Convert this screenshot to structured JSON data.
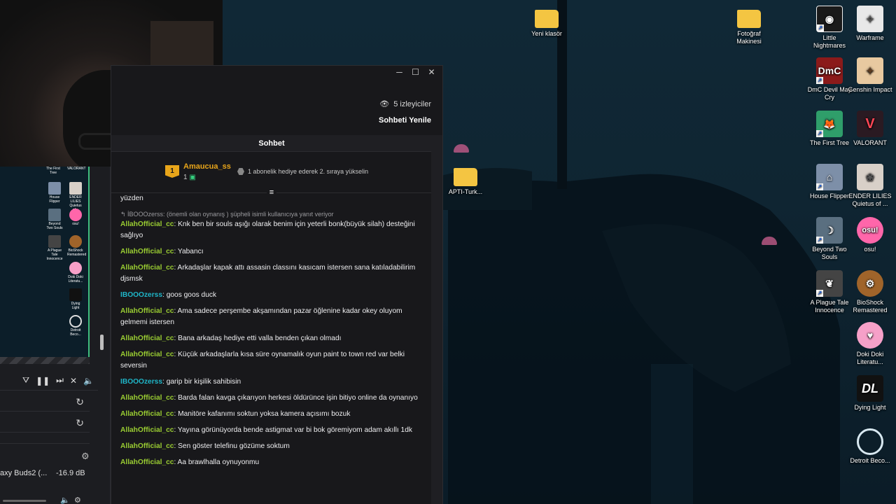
{
  "desktop": {
    "icons": [
      {
        "label": "Yeni klasör",
        "icon": "folder-icon",
        "color": "#f4c542"
      },
      {
        "label": "Fotoğraf Makinesi",
        "icon": "folder-icon",
        "color": "#f4c542"
      },
      {
        "label": "Little Nightmares",
        "icon": "eye-icon",
        "color": "#1a1a1a"
      },
      {
        "label": "Warframe",
        "icon": "warframe-icon",
        "color": "#e8e8e8"
      },
      {
        "label": "DmC Devil May Cry",
        "icon": "dmc-icon",
        "color": "#8b1a1a"
      },
      {
        "label": "Genshin Impact",
        "icon": "genshin-icon",
        "color": "#e8c9a0"
      },
      {
        "label": "The First Tree",
        "icon": "fox-icon",
        "color": "#2f9e6a"
      },
      {
        "label": "VALORANT",
        "icon": "valorant-icon",
        "color": "#ff4655"
      },
      {
        "label": "House Flipper",
        "icon": "house-icon",
        "color": "#7d8fa8"
      },
      {
        "label": "ENDER LILIES Quietus of ...",
        "icon": "ender-lilies-icon",
        "color": "#d8d0c8"
      },
      {
        "label": "Beyond Two Souls",
        "icon": "beyond-icon",
        "color": "#5a6f80"
      },
      {
        "label": "osu!",
        "icon": "osu-icon",
        "color": "#ff66aa"
      },
      {
        "label": "A Plague Tale Innocence",
        "icon": "plague-icon",
        "color": "#444444"
      },
      {
        "label": "BioShock Remastered",
        "icon": "bioshock-icon",
        "color": "#a0642a"
      },
      {
        "label": "Doki Doki Literatu...",
        "icon": "doki-icon",
        "color": "#f6a0c8"
      },
      {
        "label": "Dying Light",
        "icon": "dying-light-icon",
        "color": "#111111"
      },
      {
        "label": "Detroit Beco...",
        "icon": "detroit-icon",
        "color": "#1c3a5a"
      },
      {
        "label": "APTI-Turk...",
        "icon": "folder-icon",
        "color": "#f4c542"
      }
    ]
  },
  "obs": {
    "mini_icons": [
      "The First Tree",
      "VALORANT",
      "House Flipper",
      "ENDER LILIES Quietus of...",
      "Beyond Two Souls",
      "osu!",
      "A Plague Tale Innocence",
      "BioShock Remastered",
      "Doki Doki Literatu...",
      "Dying Light",
      "Detroit Beco..."
    ],
    "audio_device": "axy Buds2 (...",
    "audio_level": "-16.9 dB"
  },
  "chat": {
    "window_controls": {
      "minimize": "─",
      "maximize": "☐",
      "close": "✕"
    },
    "viewers": "5 izleyiciler",
    "refresh": "Sohbeti Yenile",
    "header": "Sohbet",
    "pinned": {
      "rank": "1",
      "username": "Amaucua_ss",
      "count": "1",
      "text": "1 abonelik hediye ederek 2. sıraya yükselin"
    },
    "messages": [
      {
        "user": "",
        "text": "yüzden",
        "color": "#9acd32"
      },
      {
        "reply": "İBOOOzerss: (önemli olan oynanış ) şüpheli isimli kullanıcıya yanıt veriyor"
      },
      {
        "user": "AllahOfficial_cc",
        "text": "Knk ben bir souls aşığı olarak benim için yeterli bonk(büyük silah) desteğini sağlıyo",
        "color": "#9acd32"
      },
      {
        "user": "AllahOfficial_cc",
        "text": "Yabancı",
        "color": "#9acd32"
      },
      {
        "user": "AllahOfficial_cc",
        "text": "Arkadaşlar kapak attı assasin classını kasıcam istersen sana katıladabilirim djsmsk",
        "color": "#9acd32"
      },
      {
        "user": "IBOOOzerss",
        "text": "goos goos duck",
        "color": "#1fb6c8"
      },
      {
        "user": "AllahOfficial_cc",
        "text": "Ama sadece perşembe akşamından pazar öğlenine kadar okey oluyom gelmemi istersen",
        "color": "#9acd32"
      },
      {
        "user": "AllahOfficial_cc",
        "text": "Bana arkadaş hediye etti valla benden çıkan olmadı",
        "color": "#9acd32"
      },
      {
        "user": "AllahOfficial_cc",
        "text": "Küçük arkadaşlarla kısa süre oynamalık oyun paint to town red var belki seversin",
        "color": "#9acd32"
      },
      {
        "user": "IBOOOzerss",
        "text": "garip bir kişilik sahibisin",
        "color": "#1fb6c8"
      },
      {
        "user": "AllahOfficial_cc",
        "text": "Barda falan kavga çıkarıyon herkesi öldürünce işin bitiyo online da oynanıyo",
        "color": "#9acd32"
      },
      {
        "user": "AllahOfficial_cc",
        "text": "Manitöre kafanımı soktun yoksa kamera açısımı bozuk",
        "color": "#9acd32"
      },
      {
        "user": "AllahOfficial_cc",
        "text": "Yayına görünüyorda bende astigmat var bi bok göremiyom adam akıllı 1dk",
        "color": "#9acd32"
      },
      {
        "user": "AllahOfficial_cc",
        "text": "Sen göster telefinu gözüme soktum",
        "color": "#9acd32"
      },
      {
        "user": "AllahOfficial_cc",
        "text": "Aa brawlhalla oynuyonmu",
        "color": "#9acd32"
      }
    ]
  }
}
